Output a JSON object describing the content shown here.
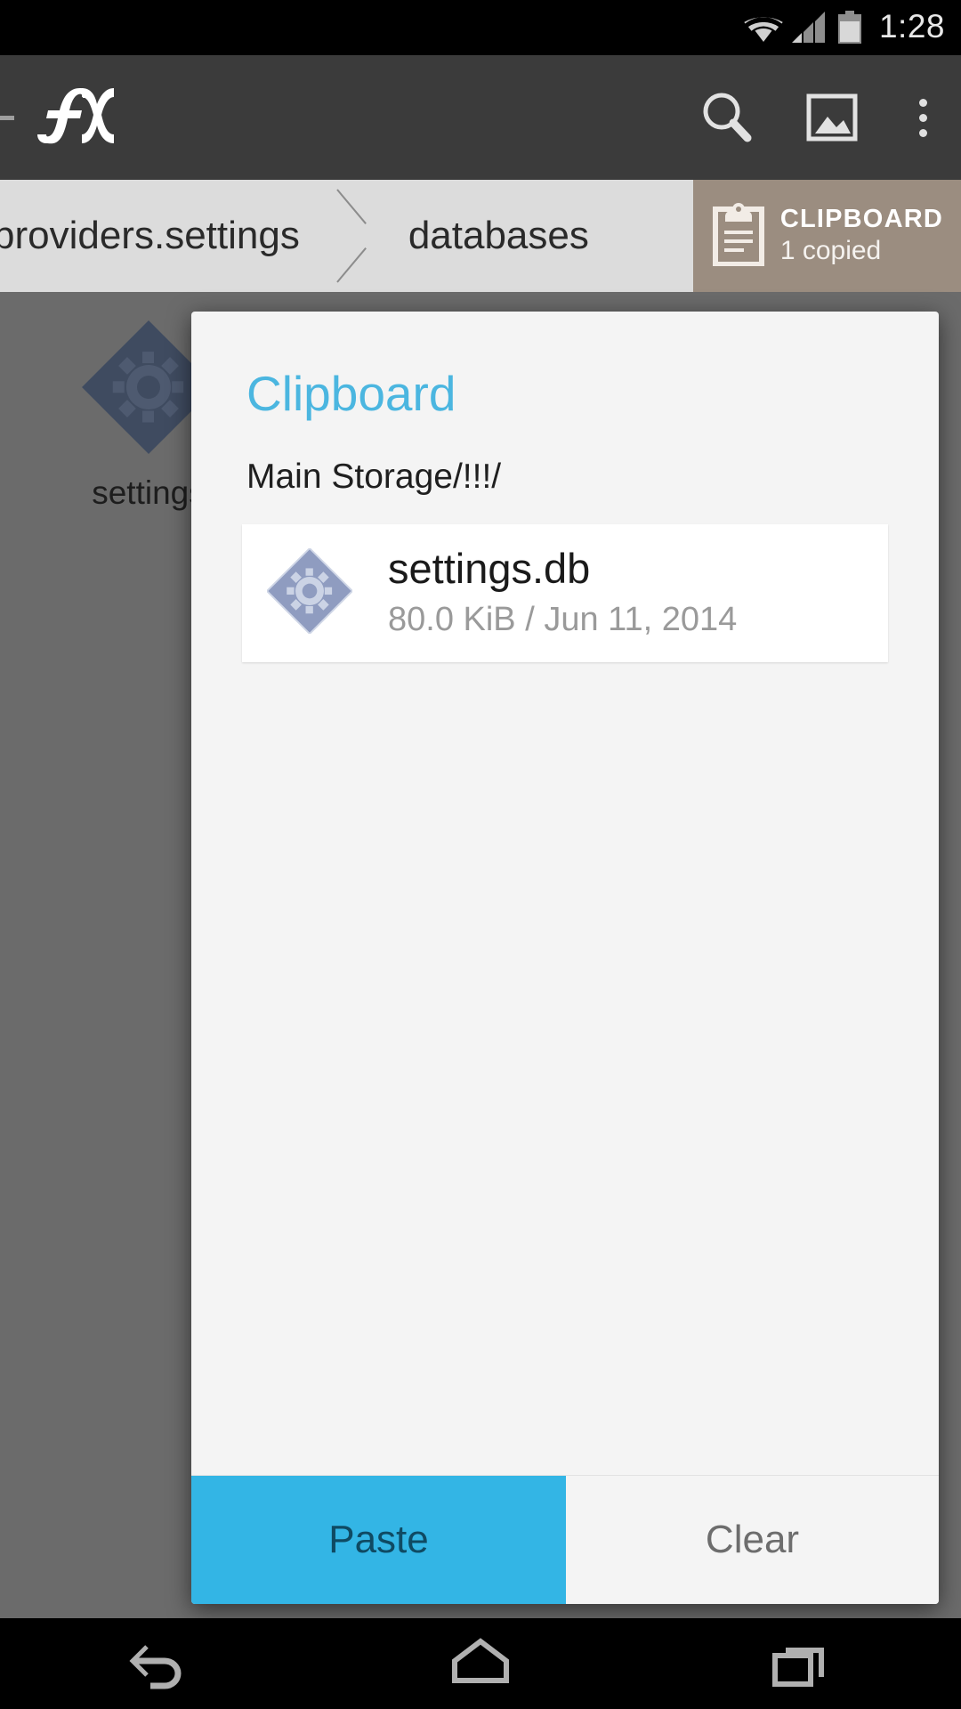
{
  "status_bar": {
    "time": "1:28",
    "icons": [
      "wifi-icon",
      "cellular-signal-icon",
      "battery-icon"
    ]
  },
  "action_bar": {
    "app_logo": "fx-logo",
    "drawer_handle": "drawer-handle",
    "actions": [
      {
        "name": "search-icon",
        "label": "Search"
      },
      {
        "name": "image-icon",
        "label": "Images"
      },
      {
        "name": "overflow-menu-icon",
        "label": "More options"
      }
    ]
  },
  "breadcrumb": {
    "crumbs": [
      {
        "label": "providers.settings"
      },
      {
        "label": "databases"
      }
    ],
    "clipboard_chip": {
      "title": "CLIPBOARD",
      "subtitle": "1 copied",
      "icon": "clipboard-icon",
      "background": "#9b8d80"
    }
  },
  "content": {
    "background_item": {
      "label": "settings",
      "icon": "settings-db-icon"
    }
  },
  "dialog": {
    "title": "Clipboard",
    "title_color": "#4bb6e0",
    "path": "Main Storage/!!!/",
    "items": [
      {
        "name": "settings.db",
        "meta": "80.0 KiB / Jun 11, 2014",
        "size": "80.0 KiB",
        "date": "Jun 11, 2014",
        "icon": "settings-db-icon"
      }
    ],
    "buttons": [
      {
        "label": "Paste",
        "style": "primary",
        "color": "#33b5e5"
      },
      {
        "label": "Clear",
        "style": "default",
        "color": "#f4f4f4"
      }
    ]
  },
  "nav_bar": {
    "buttons": [
      {
        "name": "back-icon",
        "label": "Back"
      },
      {
        "name": "home-icon",
        "label": "Home"
      },
      {
        "name": "recents-icon",
        "label": "Recent apps"
      }
    ]
  }
}
